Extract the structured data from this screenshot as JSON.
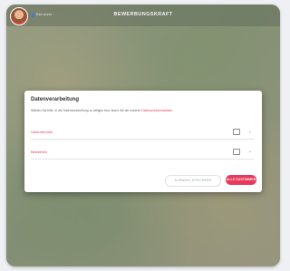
{
  "header": {
    "user_name": "Benutzer",
    "app_title": "BEWERBUNGSKRAFT"
  },
  "dialog": {
    "title": "Datenverarbeitung",
    "description": "Wählen Sie bitte, in die Datenverarbeitung zu willigen bzw. lesen Sie die unseren",
    "link_text": "Datenschutzhinweisen",
    "rows": [
      {
        "label": "Unternehmen"
      },
      {
        "label": "Bewerben"
      }
    ],
    "secondary_button": "AUSWAHL SPEICHERN",
    "primary_button": "ALLE ZUSTIMMEN"
  },
  "colors": {
    "accent": "#e8395c",
    "user_dot": "#2f6fd6"
  },
  "icons": {
    "avatar": "user-avatar",
    "chevron": "chevron-down-icon",
    "checkbox": "checkbox-icon"
  }
}
